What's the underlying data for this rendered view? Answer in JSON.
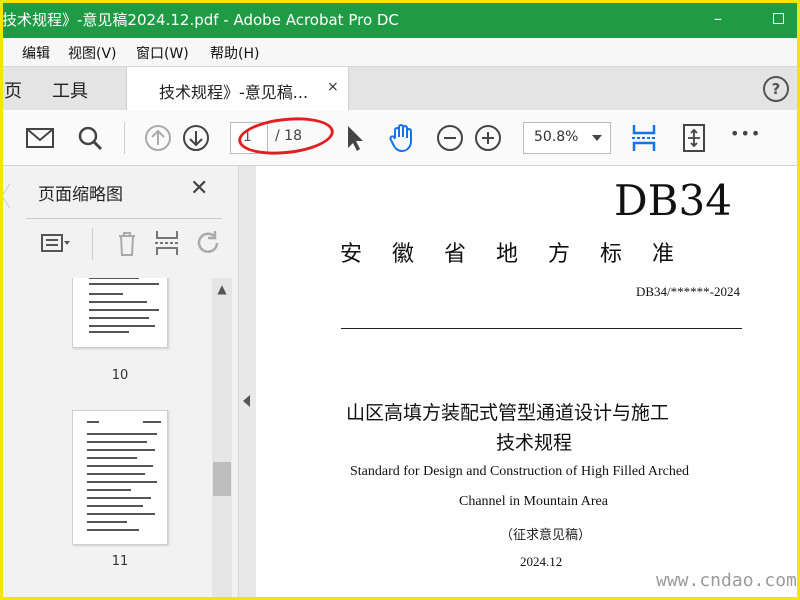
{
  "window": {
    "title": "技术规程》-意见稿2024.12.pdf - Adobe Acrobat Pro DC",
    "minimize": "–",
    "colors": {
      "titlebar": "#1f9b45",
      "frame": "#f2e600"
    }
  },
  "menu": [
    "编辑",
    "视图(V)",
    "窗口(W)",
    "帮助(H)"
  ],
  "tabs": {
    "home": "页",
    "tools": "工具",
    "document": "技术规程》-意见稿...",
    "close": "×",
    "help": "?"
  },
  "toolbar": {
    "icons": [
      "mail-icon",
      "search-icon",
      "prev-page-icon",
      "next-page-icon",
      "select-cursor-icon",
      "hand-icon",
      "zoom-out-icon",
      "zoom-in-icon",
      "scroll-mode-icon",
      "fit-page-icon",
      "more-icon"
    ],
    "page_current": "1",
    "page_total": "/ 18",
    "zoom": "50.8%",
    "more": "•••"
  },
  "thumbnail_panel": {
    "title": "页面缩略图",
    "close": "✕",
    "pages": [
      "10",
      "11"
    ],
    "scroll_up": "▲"
  },
  "document": {
    "code_big": "DB34",
    "standard_name": "安徽省地方标准",
    "standard_code": "DB34/******-2024",
    "title_cn_line1": "山区高填方装配式管型通道设计与施工",
    "title_cn_line2": "技术规程",
    "title_en_line1": "Standard for Design and Construction of High Filled Arched",
    "title_en_line2": "Channel in Mountain Area",
    "draft": "（征求意见稿）",
    "date": "2024.12"
  },
  "watermark": "www.cndao.com"
}
